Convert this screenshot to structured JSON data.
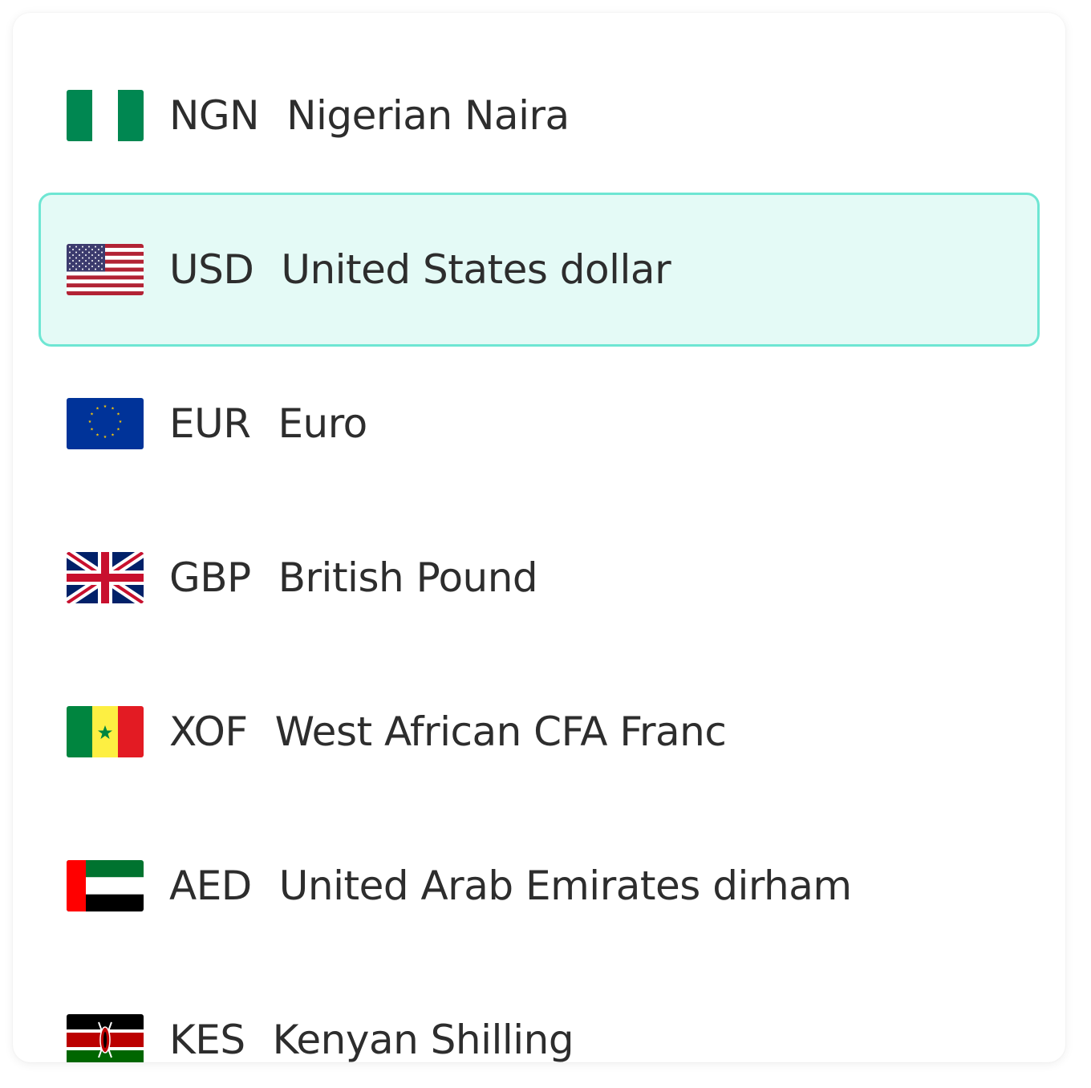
{
  "currencies": [
    {
      "code": "NGN",
      "name": "Nigerian Naira",
      "flag": "nigeria-flag-icon",
      "selected": false
    },
    {
      "code": "USD",
      "name": "United States dollar",
      "flag": "usa-flag-icon",
      "selected": true
    },
    {
      "code": "EUR",
      "name": "Euro",
      "flag": "eu-flag-icon",
      "selected": false
    },
    {
      "code": "GBP",
      "name": "British Pound",
      "flag": "uk-flag-icon",
      "selected": false
    },
    {
      "code": "XOF",
      "name": "West African CFA Franc",
      "flag": "senegal-flag-icon",
      "selected": false
    },
    {
      "code": "AED",
      "name": "United Arab Emirates dirham",
      "flag": "uae-flag-icon",
      "selected": false
    },
    {
      "code": "KES",
      "name": "Kenyan Shilling",
      "flag": "kenya-flag-icon",
      "selected": false
    }
  ],
  "colors": {
    "selected_background": "#e4faf6",
    "selected_border": "#6ee6d3",
    "text": "#2d2d2d"
  }
}
